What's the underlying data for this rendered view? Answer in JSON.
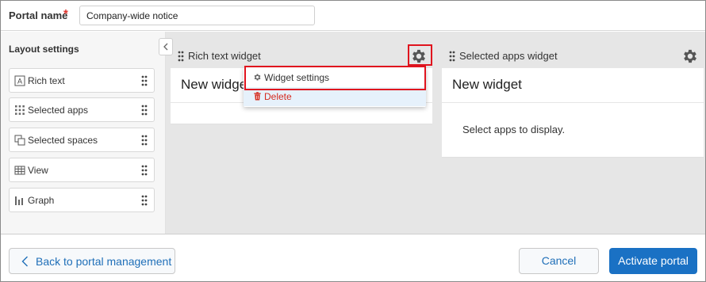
{
  "header": {
    "portal_name_label": "Portal name",
    "required_mark": "*",
    "portal_name_value": "Company-wide notice"
  },
  "sidebar": {
    "title": "Layout settings",
    "items": [
      {
        "label": "Rich text",
        "icon": "rich-text-icon"
      },
      {
        "label": "Selected apps",
        "icon": "apps-grid-icon"
      },
      {
        "label": "Selected spaces",
        "icon": "spaces-icon"
      },
      {
        "label": "View",
        "icon": "table-view-icon"
      },
      {
        "label": "Graph",
        "icon": "bar-graph-icon"
      }
    ]
  },
  "widgets": [
    {
      "header": "Rich text widget",
      "title": "New widget",
      "content": ""
    },
    {
      "header": "Selected apps widget",
      "title": "New widget",
      "content": "Select apps to display."
    }
  ],
  "menu": {
    "settings_label": "Widget settings",
    "delete_label": "Delete"
  },
  "footer": {
    "back_label": "Back to portal management",
    "cancel_label": "Cancel",
    "activate_label": "Activate portal"
  },
  "colors": {
    "accent": "#1a71c4",
    "highlight": "#e0141e",
    "delete": "#d42a1e",
    "canvas": "#e6e6e6"
  }
}
